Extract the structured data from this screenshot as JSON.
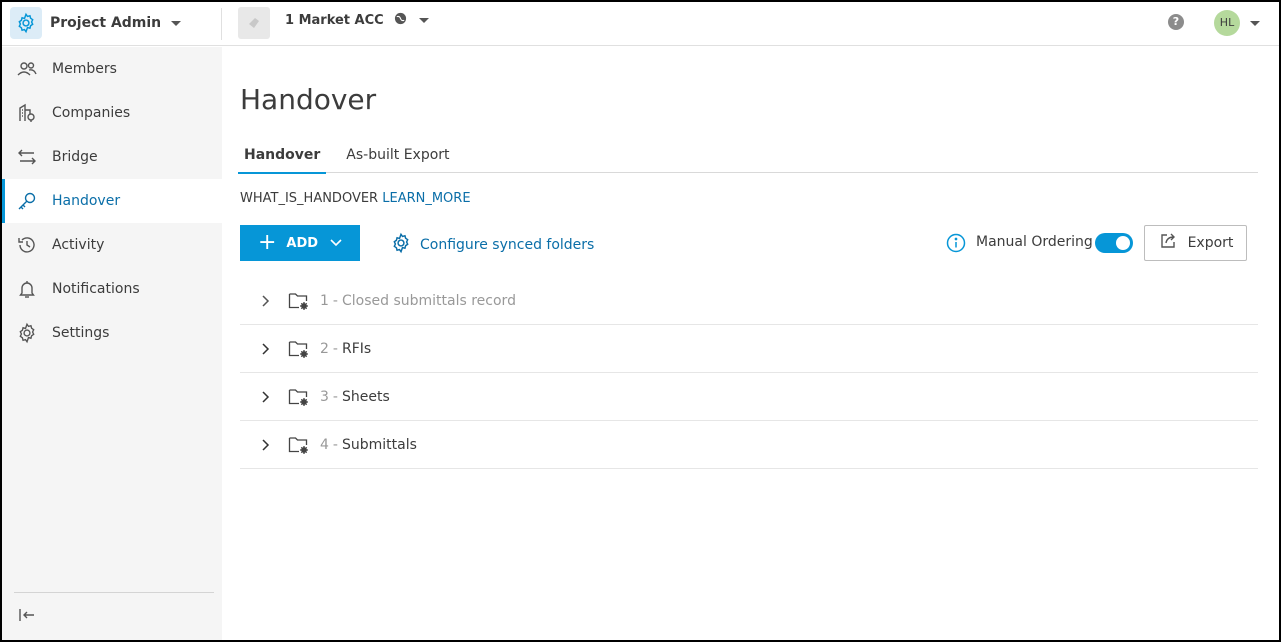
{
  "topbar": {
    "app_title": "Project Admin",
    "project_name": "1 Market ACC",
    "help_label": "?",
    "user_initials": "HL"
  },
  "sidebar": {
    "items": [
      {
        "label": "Members",
        "icon": "members-icon"
      },
      {
        "label": "Companies",
        "icon": "companies-icon"
      },
      {
        "label": "Bridge",
        "icon": "bridge-icon"
      },
      {
        "label": "Handover",
        "icon": "handover-key-icon",
        "active": true
      },
      {
        "label": "Activity",
        "icon": "activity-icon"
      },
      {
        "label": "Notifications",
        "icon": "bell-icon"
      },
      {
        "label": "Settings",
        "icon": "gear-icon"
      }
    ]
  },
  "main": {
    "title": "Handover",
    "tabs": [
      {
        "label": "Handover",
        "active": true
      },
      {
        "label": "As-built Export",
        "active": false
      }
    ],
    "info_text": "WHAT_IS_HANDOVER",
    "learn_more": "LEARN_MORE",
    "add_label": "ADD",
    "configure_label": "Configure synced folders",
    "manual_ordering_label": "Manual Ordering",
    "manual_ordering_on": true,
    "export_label": "Export",
    "folders": [
      {
        "num": "1",
        "sep": "-",
        "name": "Closed submittals record",
        "muted": true
      },
      {
        "num": "2",
        "sep": "-",
        "name": "RFIs",
        "muted": false
      },
      {
        "num": "3",
        "sep": "-",
        "name": "Sheets",
        "muted": false
      },
      {
        "num": "4",
        "sep": "-",
        "name": "Submittals",
        "muted": false
      }
    ]
  },
  "colors": {
    "accent": "#0696d7",
    "link": "#0a6ea8",
    "sidebar_bg": "#f5f5f5",
    "avatar_bg": "#b5d99c"
  }
}
